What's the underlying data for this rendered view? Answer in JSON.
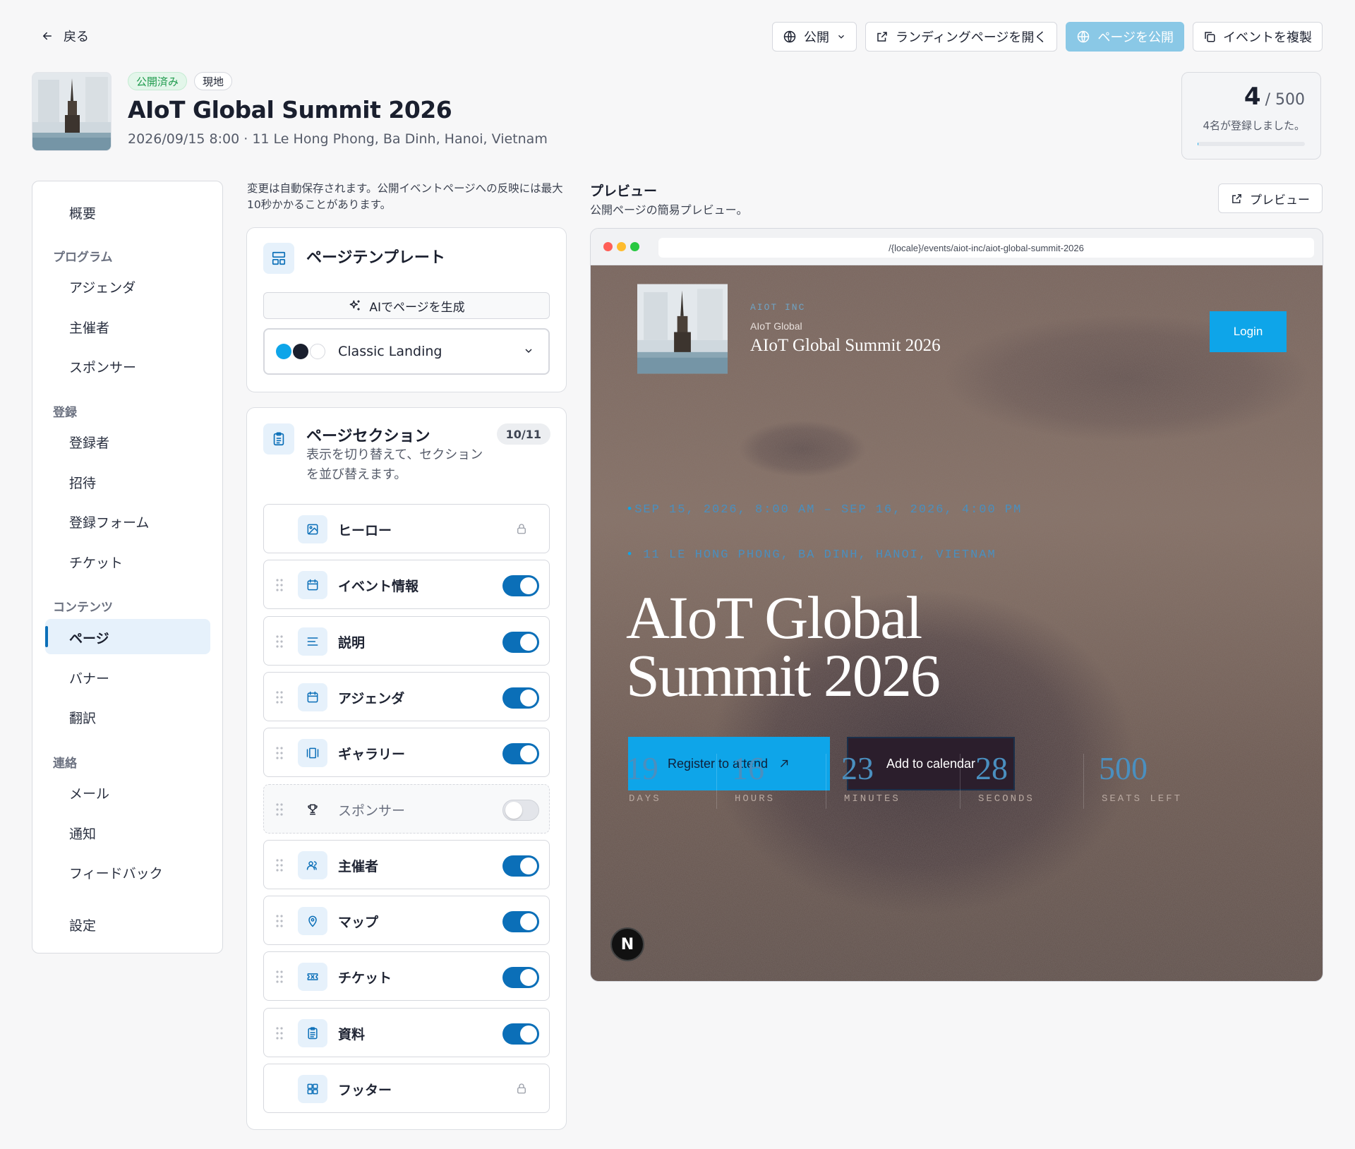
{
  "nav": {
    "back_label": "戻る"
  },
  "toolbar": {
    "public_label": "公開",
    "open_landing_label": "ランディングページを開く",
    "publish_label": "ページを公開",
    "duplicate_label": "イベントを複製"
  },
  "event": {
    "status_badge": "公開済み",
    "type_badge": "現地",
    "title": "AIoT Global Summit 2026",
    "meta": "2026/09/15 8:00 · 11 Le Hong Phong, Ba Dinh, Hanoi, Vietnam"
  },
  "registration": {
    "count": "4",
    "capacity": "/ 500",
    "summary": "4名が登録しました。",
    "fill_fraction": 0.008
  },
  "sidebar": {
    "overview": "概要",
    "sections": [
      {
        "heading": "プログラム",
        "items": [
          "アジェンダ",
          "主催者",
          "スポンサー"
        ]
      },
      {
        "heading": "登録",
        "items": [
          "登録者",
          "招待",
          "登録フォーム",
          "チケット"
        ]
      },
      {
        "heading": "コンテンツ",
        "items": [
          "ページ",
          "バナー",
          "翻訳"
        ]
      },
      {
        "heading": "連絡",
        "items": [
          "メール",
          "通知",
          "フィードバック"
        ]
      }
    ],
    "settings": "設定",
    "active_item": "ページ"
  },
  "editor": {
    "autosave_note": "変更は自動保存されます。公開イベントページへの反映には最大10秒かかることがあります。",
    "template": {
      "title": "ページテンプレート",
      "ai_button": "AIでページを生成",
      "selected_template": "Classic Landing",
      "swatch_colors": [
        "#0ea5e9",
        "#1a1f2e",
        "#ffffff"
      ]
    },
    "sections": {
      "title": "ページセクション",
      "description": "表示を切り替えて、セクションを並び替えます。",
      "count_badge": "10/11",
      "items": [
        {
          "label": "ヒーロー",
          "icon": "image-icon",
          "state": "locked"
        },
        {
          "label": "イベント情報",
          "icon": "calendar-icon",
          "state": "on"
        },
        {
          "label": "説明",
          "icon": "text-align-icon",
          "state": "on"
        },
        {
          "label": "アジェンダ",
          "icon": "calendar-icon",
          "state": "on"
        },
        {
          "label": "ギャラリー",
          "icon": "gallery-icon",
          "state": "on"
        },
        {
          "label": "スポンサー",
          "icon": "trophy-icon",
          "state": "off"
        },
        {
          "label": "主催者",
          "icon": "users-icon",
          "state": "on"
        },
        {
          "label": "マップ",
          "icon": "map-pin-icon",
          "state": "on"
        },
        {
          "label": "チケット",
          "icon": "ticket-icon",
          "state": "on"
        },
        {
          "label": "資料",
          "icon": "clipboard-icon",
          "state": "on"
        },
        {
          "label": "フッター",
          "icon": "layout-grid-icon",
          "state": "locked"
        }
      ]
    }
  },
  "preview": {
    "title": "プレビュー",
    "subtitle": "公開ページの簡易プレビュー。",
    "button_label": "プレビュー",
    "url": "/{locale}/events/aiot-inc/aiot-global-summit-2026",
    "site": {
      "org_label": "AIOT INC",
      "org_name": "AIoT Global",
      "event_name": "AIoT Global Summit 2026",
      "login_label": "Login",
      "date_line": "SEP 15, 2026, 8:00 AM – SEP 16, 2026, 4:00 PM",
      "location_line": "11 LE HONG PHONG, BA DINH, HANOI, VIETNAM",
      "hero_title_line1": "AIoT Global",
      "hero_title_line2": "Summit 2026",
      "register_label": "Register to attend",
      "calendar_label": "Add to calendar",
      "countdown": [
        {
          "value": "19",
          "unit": "DAYS"
        },
        {
          "value": "16",
          "unit": "HOURS"
        },
        {
          "value": "23",
          "unit": "MINUTES"
        },
        {
          "value": "28",
          "unit": "SECONDS"
        },
        {
          "value": "500",
          "unit": "SEATS LEFT"
        }
      ],
      "badge_letter": "N"
    },
    "accent_color": "#0ea5e9"
  }
}
